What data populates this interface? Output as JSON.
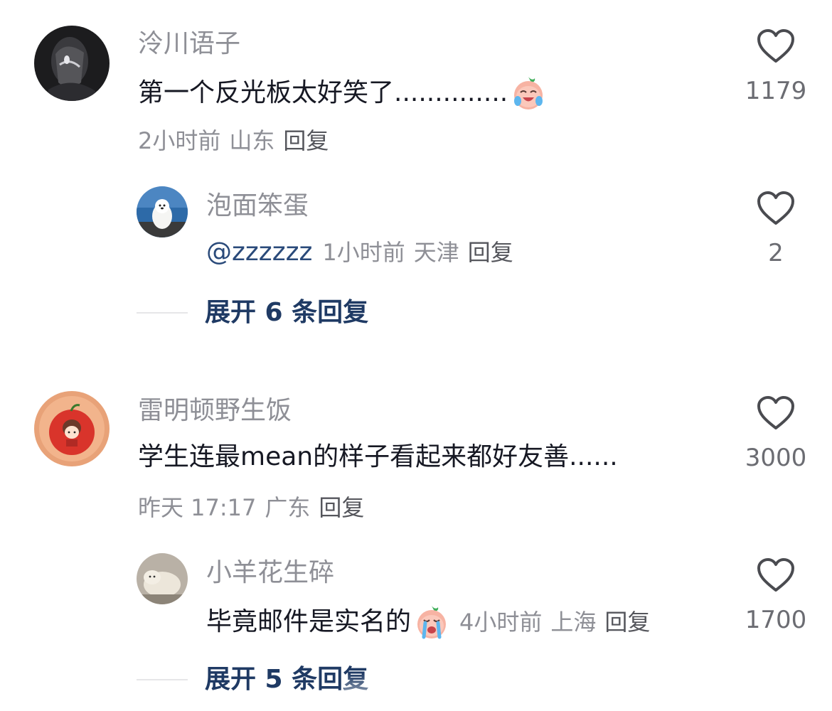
{
  "comments": [
    {
      "username": "泠川语子",
      "text": "第一个反光板太好笑了..............",
      "emoji": "crying-laughing-peach-emoji",
      "time": "2小时前",
      "location": "山东",
      "reply_label": "回复",
      "likes": "1179",
      "replies": [
        {
          "username": "泡面笨蛋",
          "mention": "@zzzzzz",
          "time": "1小时前",
          "location": "天津",
          "reply_label": "回复",
          "likes": "2"
        }
      ],
      "expand_label": "展开 6 条回复"
    },
    {
      "username": "雷明顿野生饭",
      "text": "学生连最mean的样子看起来都好友善......",
      "time": "昨天 17:17",
      "location": "广东",
      "reply_label": "回复",
      "likes": "3000",
      "replies": [
        {
          "username": "小羊花生碎",
          "text": "毕竟邮件是实名的",
          "emoji": "crying-peach-emoji",
          "time": "4小时前",
          "location": "上海",
          "reply_label": "回复",
          "likes": "1700"
        }
      ],
      "expand_label": "展开 5 条回复"
    }
  ],
  "colors": {
    "username": "#8e8f96",
    "text": "#161823",
    "expand": "#1f3a64",
    "mention": "#2a4a7a"
  }
}
